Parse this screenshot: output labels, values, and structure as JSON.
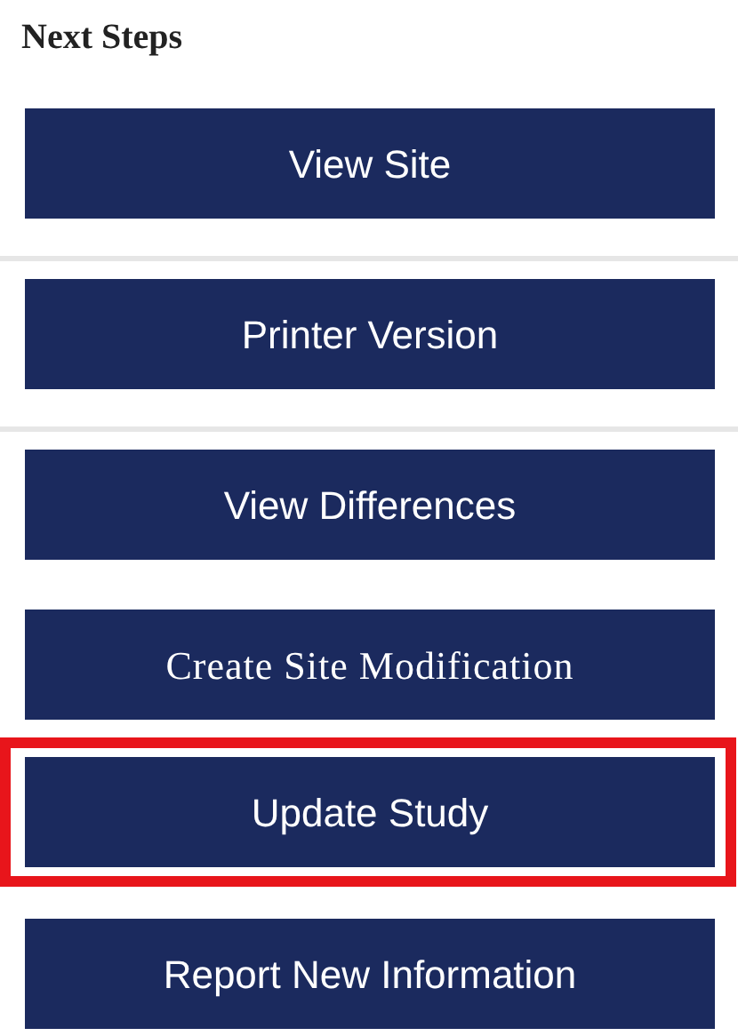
{
  "title": "Next Steps",
  "buttons": [
    {
      "label": "View Site",
      "kind": "sans",
      "separated": true,
      "highlighted": false
    },
    {
      "label": "Printer Version",
      "kind": "sans",
      "separated": true,
      "highlighted": false
    },
    {
      "label": "View Differences",
      "kind": "sans",
      "separated": false,
      "highlighted": false
    },
    {
      "label": "Create Site Modification",
      "kind": "serif",
      "separated": false,
      "highlighted": false
    },
    {
      "label": "Update Study",
      "kind": "sans",
      "separated": false,
      "highlighted": true
    },
    {
      "label": "Report New Information",
      "kind": "sans",
      "separated": false,
      "highlighted": false
    }
  ]
}
